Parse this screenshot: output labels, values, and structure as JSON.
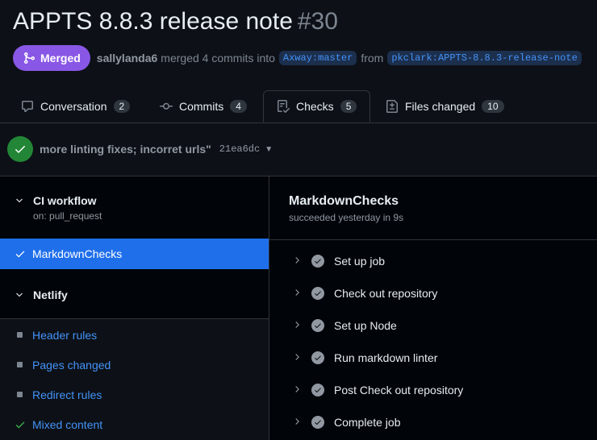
{
  "pr": {
    "title": "APPTS 8.8.3 release note",
    "number": "#30",
    "status": "Merged",
    "author": "sallylanda6",
    "merge_text": "merged 4 commits into",
    "base_branch": "Axway:master",
    "from_text": "from",
    "head_branch": "pkclark:APPTS-8.8.3-release-note"
  },
  "tabs": [
    {
      "label": "Conversation",
      "count": "2",
      "icon": "comment-icon"
    },
    {
      "label": "Commits",
      "count": "4",
      "icon": "commit-icon"
    },
    {
      "label": "Checks",
      "count": "5",
      "icon": "checklist-icon"
    },
    {
      "label": "Files changed",
      "count": "10",
      "icon": "file-diff-icon"
    }
  ],
  "commit": {
    "message": "more linting fixes; incorret urls\"",
    "sha": "21ea6dc"
  },
  "sidebar": {
    "workflow": {
      "name": "CI workflow",
      "trigger": "on: pull_request"
    },
    "active_job": "MarkdownChecks",
    "netlify": {
      "name": "Netlify",
      "items": [
        "Header rules",
        "Pages changed",
        "Redirect rules",
        "Mixed content"
      ]
    }
  },
  "job": {
    "title": "MarkdownChecks",
    "status": "succeeded yesterday in 9s",
    "steps": [
      "Set up job",
      "Check out repository",
      "Set up Node",
      "Run markdown linter",
      "Post Check out repository",
      "Complete job"
    ]
  },
  "colors": {
    "merged": "#8957e5",
    "success": "#238636",
    "accent": "#1f6feb",
    "link": "#4493f8"
  }
}
